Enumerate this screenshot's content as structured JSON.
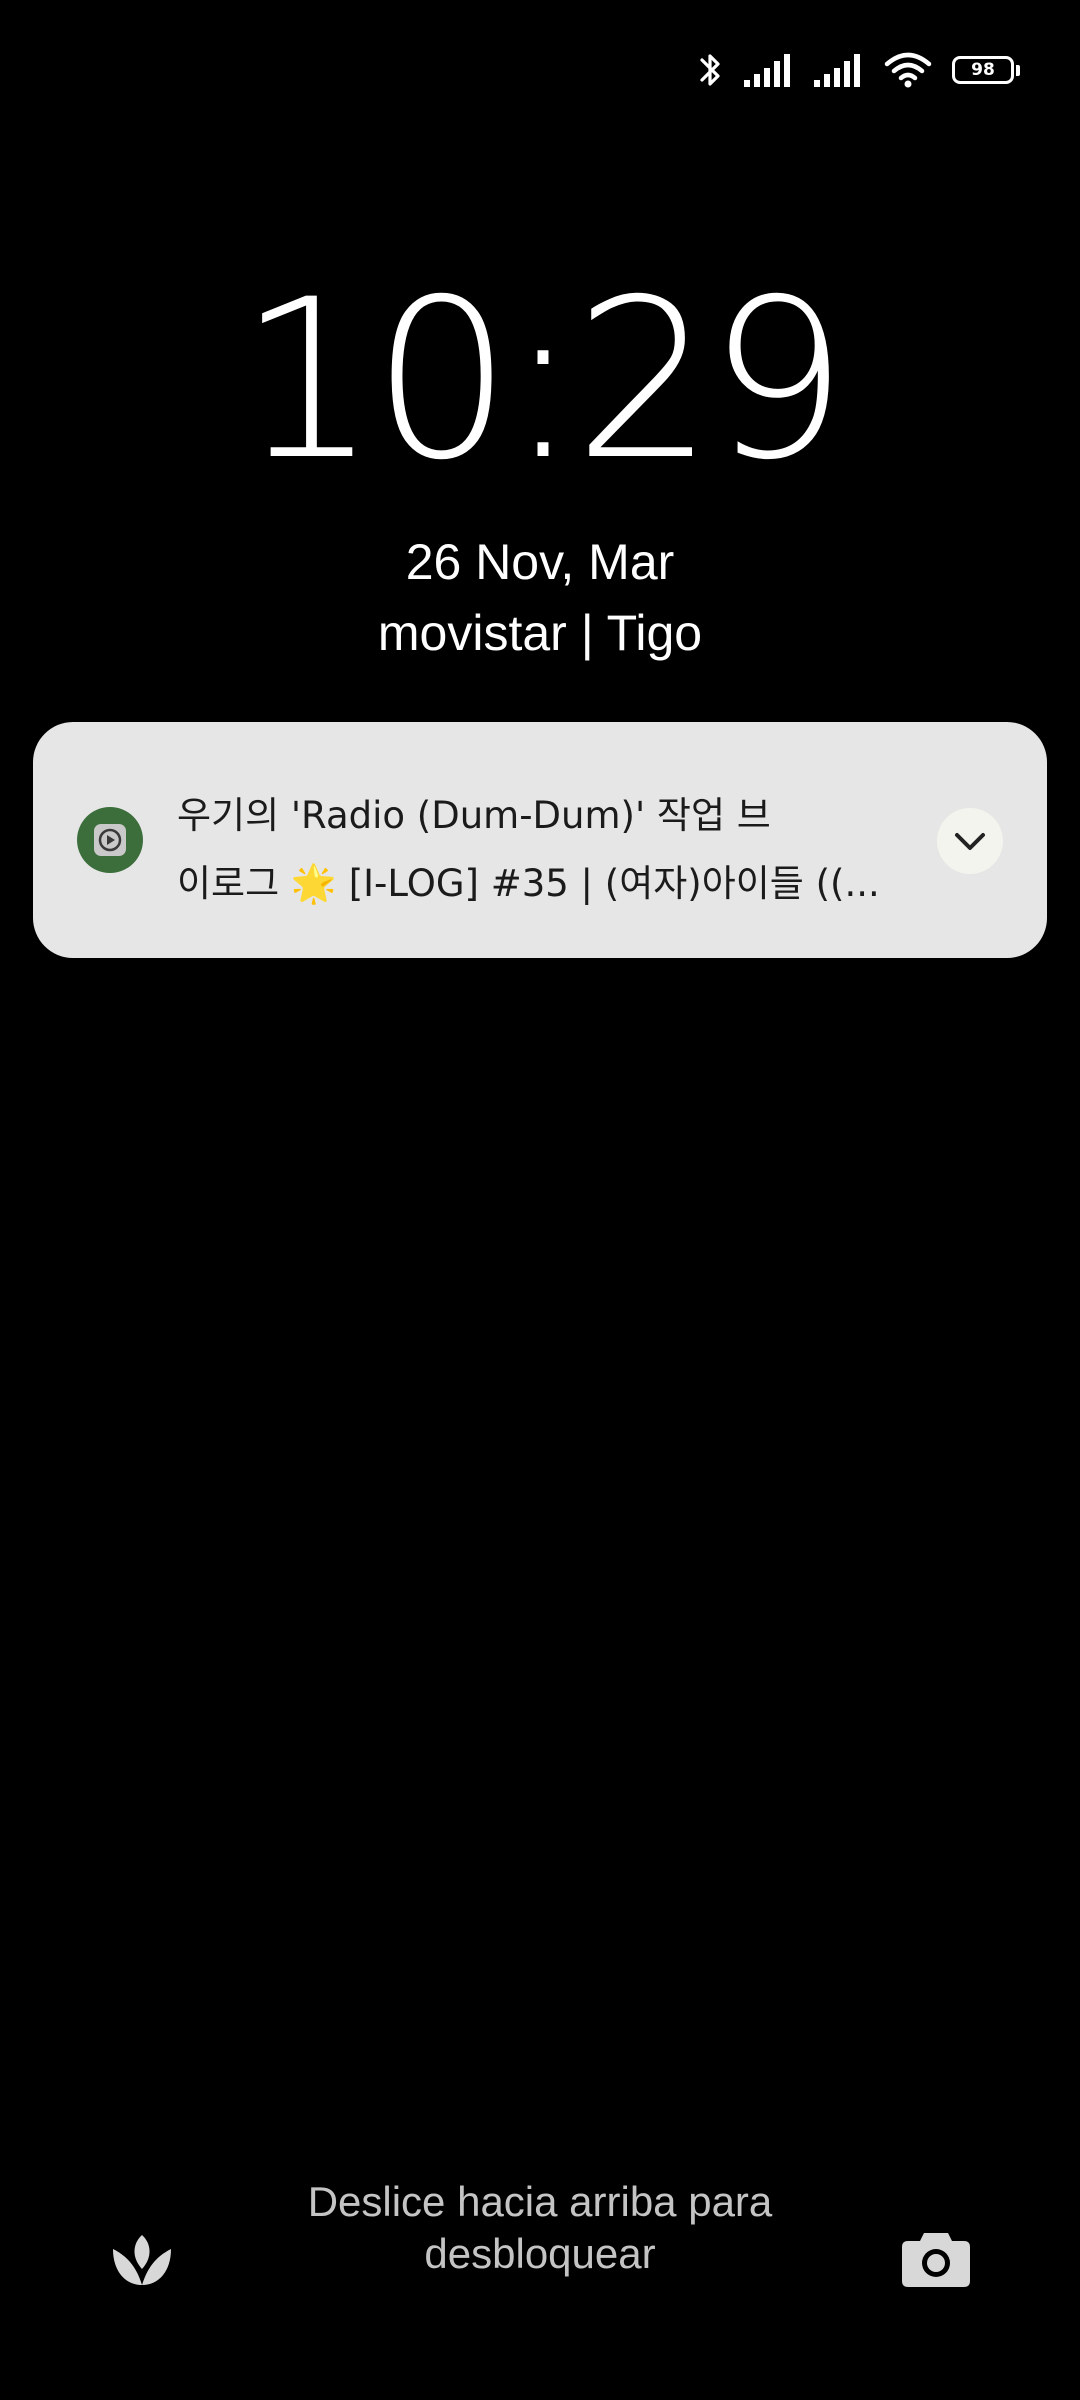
{
  "status_bar": {
    "icons": [
      "bluetooth-icon",
      "signal-icon",
      "signal-icon",
      "wifi-icon",
      "battery-icon"
    ],
    "battery_level": "98"
  },
  "lockscreen": {
    "time": "10:29",
    "date": "26 Nov, Mar",
    "carrier": "movistar | Tigo",
    "unlock_hint": "Deslice hacia arriba para desbloquear"
  },
  "notification": {
    "app_icon": "media-player-icon",
    "line1": "우기의 'Radio (Dum-Dum)' 작업 브",
    "line2": "이로그 🌟 [I-LOG] #35 | (여자)아이들 ((...",
    "expand_icon": "chevron-down-icon"
  },
  "bottom_shortcuts": {
    "left_icon": "flower-icon",
    "right_icon": "camera-icon"
  },
  "colors": {
    "background": "#000000",
    "notification_bg": "#e6e6e6",
    "app_icon_bg": "#3c6e3c",
    "hint_text": "#c4c4c4"
  }
}
